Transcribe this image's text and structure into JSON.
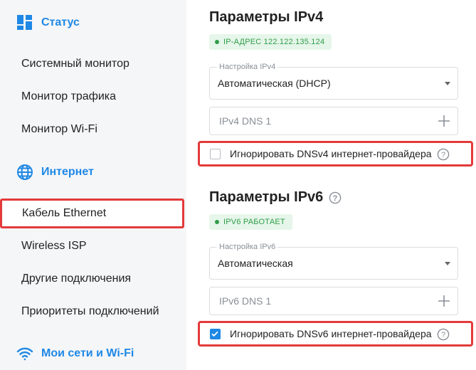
{
  "sidebar": {
    "status": {
      "label": "Статус",
      "icon": "dashboard-icon"
    },
    "status_items": [
      "Системный монитор",
      "Монитор трафика",
      "Монитор Wi-Fi"
    ],
    "internet": {
      "label": "Интернет",
      "icon": "globe-icon"
    },
    "internet_items": [
      "Кабель Ethernet",
      "Wireless ISP",
      "Другие подключения",
      "Приоритеты подключений"
    ],
    "active_item": "Кабель Ethernet",
    "wifi": {
      "label": "Мои сети и Wi-Fi",
      "icon": "wifi-icon"
    }
  },
  "ipv4": {
    "title": "Параметры IPv4",
    "badge": "IP-АДРЕС 122.122.135.124",
    "setting_label": "Настройка IPv4",
    "setting_value": "Автоматическая (DHCP)",
    "dns_placeholder": "IPv4 DNS 1",
    "ignore_label": "Игнорировать DNSv4 интернет-провайдера",
    "ignore_checked": false
  },
  "ipv6": {
    "title": "Параметры IPv6",
    "badge": "IPV6 РАБОТАЕТ",
    "setting_label": "Настройка IPv6",
    "setting_value": "Автоматическая",
    "dns_placeholder": "IPv6 DNS 1",
    "ignore_label": "Игнорировать DNSv6 интернет-провайдера",
    "ignore_checked": true
  },
  "colors": {
    "accent": "#1e88e5",
    "highlight": "#e33a3a",
    "success": "#2e9d48"
  }
}
